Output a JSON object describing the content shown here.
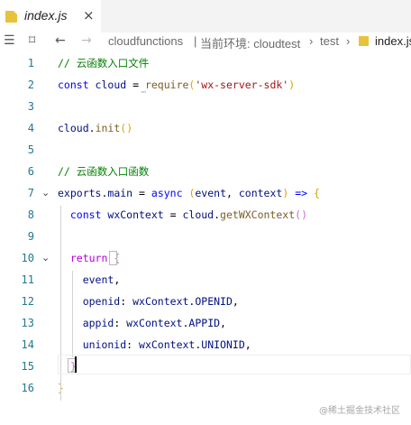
{
  "tab": {
    "filename": "index.js",
    "close": "×"
  },
  "toolbar": {
    "menu_icon": "☰",
    "bookmark_icon": "⌑",
    "back_icon": "←",
    "forward_icon": "→",
    "breadcrumb": {
      "root": "cloudfunctions",
      "sep1": "|",
      "env": "当前环境: cloudtest",
      "arrow1": "›",
      "folder": "test",
      "arrow2": "›",
      "file": "index.js"
    }
  },
  "editor": {
    "lines": [
      {
        "n": "1",
        "tokens": [
          {
            "t": "// 云函数入口文件",
            "c": "c-comment"
          }
        ]
      },
      {
        "n": "2",
        "tokens": [
          {
            "t": "const ",
            "c": "c-kw"
          },
          {
            "t": "cloud",
            "c": "c-var"
          },
          {
            "t": " = ",
            "c": ""
          },
          {
            "t": "require",
            "c": "c-fn"
          },
          {
            "t": "(",
            "c": "c-b2"
          },
          {
            "t": "'wx-server-sdk'",
            "c": "c-str"
          },
          {
            "t": ")",
            "c": "c-b2"
          }
        ]
      },
      {
        "n": "3",
        "tokens": []
      },
      {
        "n": "4",
        "tokens": [
          {
            "t": "cloud",
            "c": "c-var"
          },
          {
            "t": ".",
            "c": ""
          },
          {
            "t": "init",
            "c": "c-fn"
          },
          {
            "t": "()",
            "c": "c-b2"
          }
        ]
      },
      {
        "n": "5",
        "tokens": []
      },
      {
        "n": "6",
        "tokens": [
          {
            "t": "// 云函数入口函数",
            "c": "c-comment"
          }
        ]
      },
      {
        "n": "7",
        "tokens": [
          {
            "t": "exports",
            "c": "c-var"
          },
          {
            "t": ".",
            "c": ""
          },
          {
            "t": "main",
            "c": "c-var"
          },
          {
            "t": " = ",
            "c": ""
          },
          {
            "t": "async ",
            "c": "c-kw"
          },
          {
            "t": "(",
            "c": "c-b2"
          },
          {
            "t": "event",
            "c": "c-var"
          },
          {
            "t": ", ",
            "c": ""
          },
          {
            "t": "context",
            "c": "c-var"
          },
          {
            "t": ")",
            "c": "c-b2"
          },
          {
            "t": " => ",
            "c": "c-kw"
          },
          {
            "t": "{",
            "c": "c-b2"
          }
        ]
      },
      {
        "n": "8",
        "tokens": [
          {
            "t": "  const ",
            "c": "c-kw"
          },
          {
            "t": "wxContext",
            "c": "c-var"
          },
          {
            "t": " = ",
            "c": ""
          },
          {
            "t": "cloud",
            "c": "c-var"
          },
          {
            "t": ".",
            "c": ""
          },
          {
            "t": "getWXContext",
            "c": "c-fn"
          },
          {
            "t": "()",
            "c": "c-b3"
          }
        ]
      },
      {
        "n": "9",
        "tokens": []
      },
      {
        "n": "10",
        "tokens": [
          {
            "t": "  return ",
            "c": "c-kwc"
          },
          {
            "t": "{",
            "c": "c-b3"
          }
        ]
      },
      {
        "n": "11",
        "tokens": [
          {
            "t": "    event",
            "c": "c-var"
          },
          {
            "t": ",",
            "c": ""
          }
        ]
      },
      {
        "n": "12",
        "tokens": [
          {
            "t": "    openid",
            "c": "c-var"
          },
          {
            "t": ": ",
            "c": ""
          },
          {
            "t": "wxContext",
            "c": "c-var"
          },
          {
            "t": ".",
            "c": ""
          },
          {
            "t": "OPENID",
            "c": "c-var"
          },
          {
            "t": ",",
            "c": ""
          }
        ]
      },
      {
        "n": "13",
        "tokens": [
          {
            "t": "    appid",
            "c": "c-var"
          },
          {
            "t": ": ",
            "c": ""
          },
          {
            "t": "wxContext",
            "c": "c-var"
          },
          {
            "t": ".",
            "c": ""
          },
          {
            "t": "APPID",
            "c": "c-var"
          },
          {
            "t": ",",
            "c": ""
          }
        ]
      },
      {
        "n": "14",
        "tokens": [
          {
            "t": "    unionid",
            "c": "c-var"
          },
          {
            "t": ": ",
            "c": ""
          },
          {
            "t": "wxContext",
            "c": "c-var"
          },
          {
            "t": ".",
            "c": ""
          },
          {
            "t": "UNIONID",
            "c": "c-var"
          },
          {
            "t": ",",
            "c": ""
          }
        ]
      },
      {
        "n": "15",
        "tokens": [
          {
            "t": "  }",
            "c": "c-b3"
          }
        ]
      },
      {
        "n": "16",
        "tokens": [
          {
            "t": "}",
            "c": "c-b2"
          }
        ]
      }
    ],
    "fold_marks": {
      "7": "⌄",
      "10": "⌄"
    },
    "squiggle": "···"
  },
  "watermark": "@稀土掘金技术社区"
}
